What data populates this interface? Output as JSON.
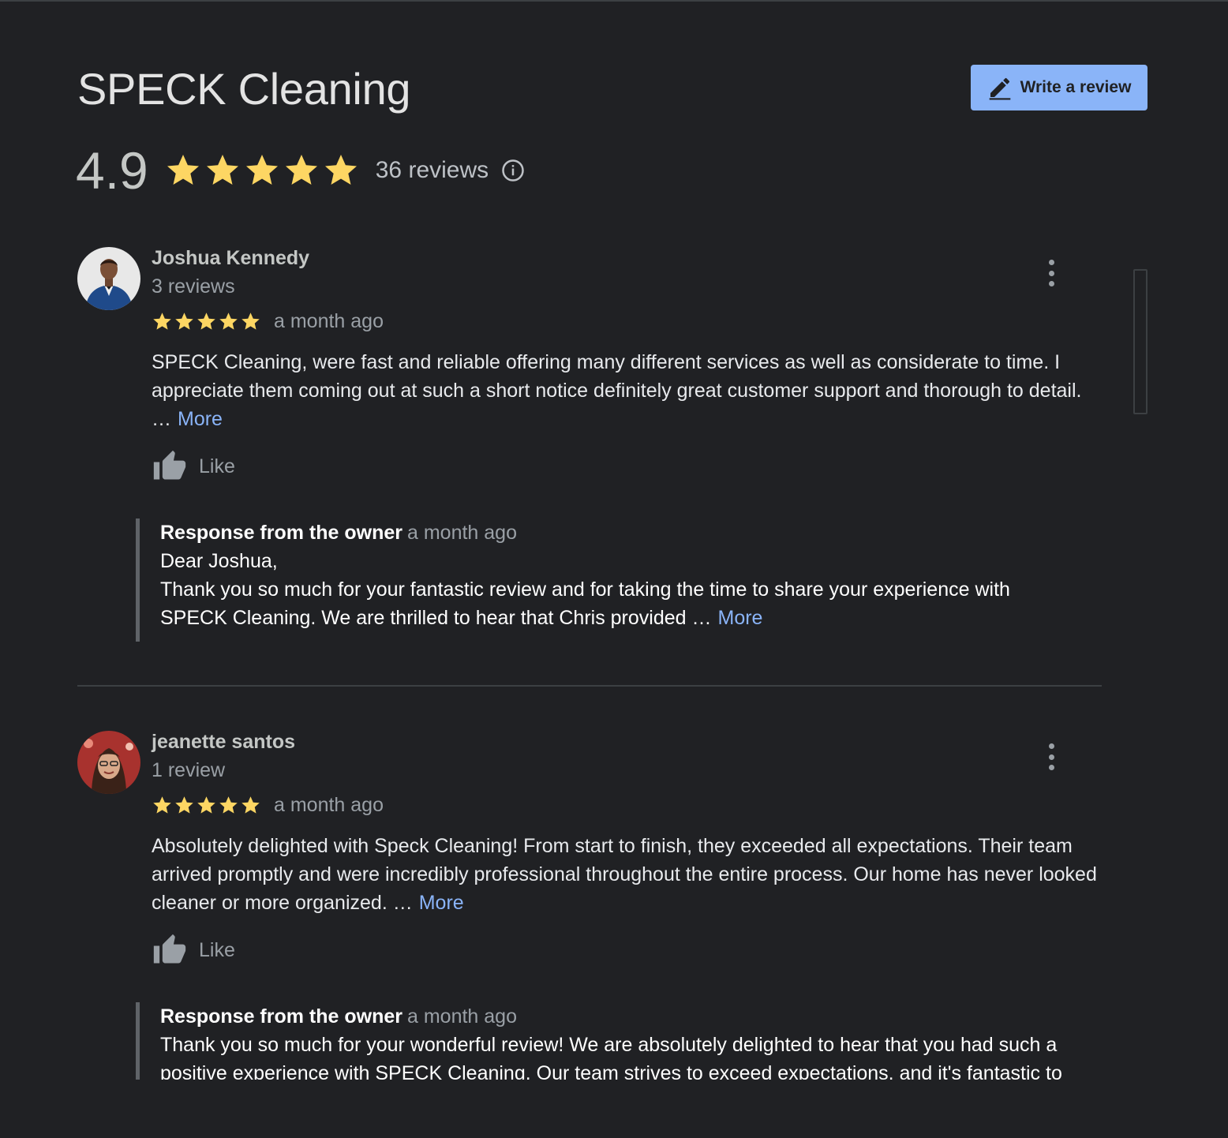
{
  "business": {
    "name": "SPECK Cleaning",
    "rating": "4.9",
    "star_count": 5,
    "reviews_label": "36 reviews",
    "write_review_label": "Write a review"
  },
  "colors": {
    "accent": "#8ab4f8",
    "star": "#fdd663",
    "background": "#202124"
  },
  "icons": {
    "write": "pencil-icon",
    "info": "info-icon",
    "like": "thumbs-up-icon",
    "menu": "more-vert-icon"
  },
  "reviews": [
    {
      "author": "Joshua Kennedy",
      "author_meta": "3 reviews",
      "stars": 5,
      "date": "a month ago",
      "text": "SPECK Cleaning, were fast and reliable offering many different services as well as considerate to time. I appreciate them coming out at such a short notice definitely great customer support and thorough to detail. …",
      "more_label": "More",
      "like_label": "Like",
      "owner_response": {
        "title": "Response from the owner",
        "date": "a month ago",
        "greeting": "Dear Joshua,",
        "text": "Thank you so much for your fantastic review and for taking the time to share your experience with SPECK Cleaning. We are thrilled to hear that Chris provided …",
        "more_label": "More"
      }
    },
    {
      "author": "jeanette santos",
      "author_meta": "1 review",
      "stars": 5,
      "date": "a month ago",
      "text": "Absolutely delighted with Speck Cleaning! From start to finish, they exceeded all expectations. Their team arrived promptly and were incredibly professional throughout the entire process. Our home has never looked cleaner or more organized. …",
      "more_label": "More",
      "like_label": "Like",
      "owner_response": {
        "title": "Response from the owner",
        "date": "a month ago",
        "text": "Thank you so much for your wonderful review! We are absolutely delighted to hear that you had such a positive experience with SPECK Cleaning. Our team strives to exceed expectations, and it's fantastic to"
      }
    }
  ]
}
